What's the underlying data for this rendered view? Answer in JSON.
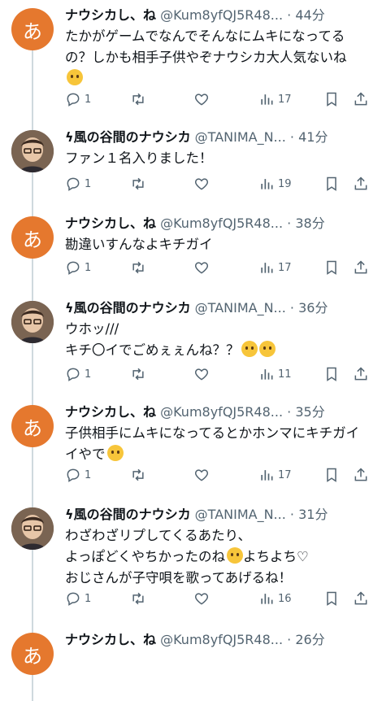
{
  "tweets": [
    {
      "author": "nausicaa_fan",
      "name": "ナウシカし、ね",
      "handle": "@Kum8yfQJ5R48...",
      "dot": "·",
      "time": "44分",
      "lines": [
        "たかがゲームでなんでそんなにムキになってる",
        "の？しかも相手子供やぞナウシカ大人気ないね"
      ],
      "emoji_after_line": 2,
      "replies": "1",
      "views": "17"
    },
    {
      "author": "tanima",
      "name_prefix": "ϟ",
      "name": "風の谷間のナウシカ",
      "handle": "@TANIMA_N...",
      "dot": "·",
      "time": "41分",
      "lines": [
        "ファン１名入りました！"
      ],
      "replies": "1",
      "views": "19"
    },
    {
      "author": "nausicaa_fan",
      "name": "ナウシカし、ね",
      "handle": "@Kum8yfQJ5R48...",
      "dot": "·",
      "time": "38分",
      "lines": [
        "勘違いすんなよキチガイ"
      ],
      "replies": "1",
      "views": "17"
    },
    {
      "author": "tanima",
      "name_prefix": "ϟ",
      "name": "風の谷間のナウシカ",
      "handle": "@TANIMA_N...",
      "dot": "·",
      "time": "36分",
      "lines": [
        "ウホッ///",
        "キチ〇イでごめぇぇんね？？"
      ],
      "emoji_line2": true,
      "replies": "1",
      "views": "11"
    },
    {
      "author": "nausicaa_fan",
      "name": "ナウシカし、ね",
      "handle": "@Kum8yfQJ5R48...",
      "dot": "·",
      "time": "35分",
      "lines": [
        "子供相手にムキになってるとかホンマにキチガイ",
        "イやで"
      ],
      "replies": "1",
      "views": "17"
    },
    {
      "author": "tanima",
      "name_prefix": "ϟ",
      "name": "風の谷間のナウシカ",
      "handle": "@TANIMA_N...",
      "dot": "·",
      "time": "31分",
      "lines": [
        "わざわざリプしてくるあたり、",
        "よっぽどくやちかったのね",
        "おじさんが子守唄を歌ってあげるね！"
      ],
      "line2_suffix": "よちよち♡",
      "replies": "1",
      "views": "16"
    },
    {
      "author": "nausicaa_fan",
      "name": "ナウシカし、ね",
      "handle": "@Kum8yfQJ5R48...",
      "dot": "·",
      "time": "26分",
      "lines": []
    }
  ],
  "avatar_letter": "あ",
  "colors": {
    "accent_avatar": "#e5782e",
    "muted": "#536471",
    "thread_line": "#cfd9de"
  }
}
